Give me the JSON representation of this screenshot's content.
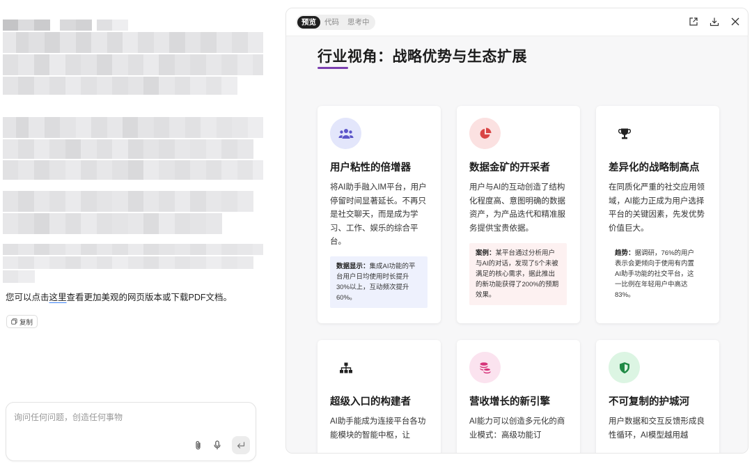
{
  "chat": {
    "message_before_link": "您可以点击",
    "link_text": "这里",
    "message_after_link": "查看更加美观的网页版本或下载PDF文档。",
    "copy_label": "复制",
    "input_placeholder": "询问任何问题，创造任何事物",
    "icons": [
      "copy-icon",
      "paperclip-icon",
      "microphone-icon",
      "send-icon"
    ]
  },
  "preview": {
    "tabs": [
      {
        "label": "预览",
        "active": true
      },
      {
        "label": "代码",
        "active": false
      },
      {
        "label": "思考中",
        "active": false
      }
    ],
    "top_icons": [
      "open-external-icon",
      "download-icon",
      "close-icon"
    ],
    "page_title": "行业视角：战略优势与生态扩展",
    "accent_color": "#7b3fb0",
    "cards": [
      {
        "icon": "users-icon",
        "icon_bg": "#e3e6fb",
        "icon_color": "#5b55c9",
        "title": "用户粘性的倍增器",
        "desc": "将AI助手融入IM平台，用户停留时间显著延长。不再只是社交聊天，而是成为学习、工作、娱乐的综合平台。",
        "note_label": "数据显示：",
        "note_text": "集成AI功能的平台用户日均使用时长提升30%以上，互动频次提升60%。",
        "note_style": "blue"
      },
      {
        "icon": "pie-chart-icon",
        "icon_bg": "#fbe1e1",
        "icon_color": "#d94646",
        "title": "数据金矿的开采者",
        "desc": "用户与AI的互动创造了结构化程度高、意图明确的数据资产，为产品迭代和精准服务提供宝贵依据。",
        "note_label": "案例：",
        "note_text": "某平台通过分析用户与AI的对话，发现了5个未被满足的核心需求，据此推出的新功能获得了200%的预期效果。",
        "note_style": "pink"
      },
      {
        "icon": "trophy-icon",
        "icon_bg": "#ffffff",
        "icon_color": "#222222",
        "title": "差异化的战略制高点",
        "desc": "在同质化严重的社交应用领域，AI能力正成为用户选择平台的关键因素，先发优势价值巨大。",
        "note_label": "趋势：",
        "note_text": "据调研，76%的用户表示会更倾向于使用有内置AI助手功能的社交平台，这一比例在年轻用户中高达83%。",
        "note_style": "white"
      },
      {
        "icon": "sitemap-icon",
        "icon_bg": "#ffffff",
        "icon_color": "#222222",
        "title": "超级入口的构建者",
        "desc": "AI助手能成为连接平台各功能模块的智能中枢，让"
      },
      {
        "icon": "coins-icon",
        "icon_bg": "#fbe3ef",
        "icon_color": "#d6337a",
        "title": "营收增长的新引擎",
        "desc": "AI能力可以创造多元化的商业模式：高级功能订"
      },
      {
        "icon": "shield-icon",
        "icon_bg": "#dcf5e3",
        "icon_color": "#1f8a45",
        "title": "不可复制的护城河",
        "desc": "用户数据和交互反馈形成良性循环，AI模型越用越"
      }
    ]
  }
}
